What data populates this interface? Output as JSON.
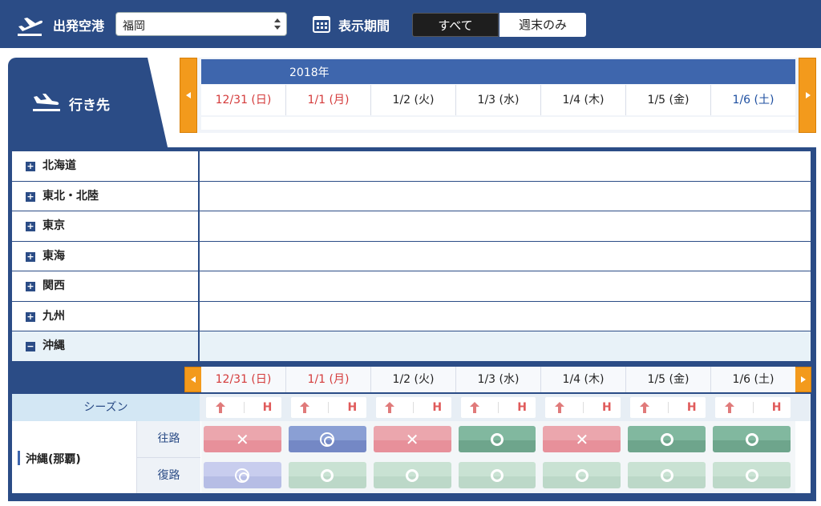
{
  "header": {
    "departure_label": "出発空港",
    "departure_value": "福岡",
    "period_label": "表示期間",
    "period_options": [
      "すべて",
      "週末のみ"
    ],
    "period_selected": "すべて"
  },
  "destination_tab_label": "行き先",
  "calendar": {
    "year_label": "2018年",
    "dates": [
      {
        "label": "12/31 (日)",
        "kind": "holiday"
      },
      {
        "label": "1/1 (月)",
        "kind": "holiday"
      },
      {
        "label": "1/2 (火)",
        "kind": "weekday"
      },
      {
        "label": "1/3 (水)",
        "kind": "weekday"
      },
      {
        "label": "1/4 (木)",
        "kind": "weekday"
      },
      {
        "label": "1/5 (金)",
        "kind": "weekday"
      },
      {
        "label": "1/6 (土)",
        "kind": "saturday"
      }
    ]
  },
  "regions": [
    {
      "name": "北海道",
      "expanded": false
    },
    {
      "name": "東北・北陸",
      "expanded": false
    },
    {
      "name": "東京",
      "expanded": false
    },
    {
      "name": "東海",
      "expanded": false
    },
    {
      "name": "関西",
      "expanded": false
    },
    {
      "name": "九州",
      "expanded": false
    },
    {
      "name": "沖縄",
      "expanded": true
    }
  ],
  "okinawa": {
    "season_label": "シーズン",
    "season_mark": "H",
    "route_name": "沖縄(那覇)",
    "outbound_label": "往路",
    "return_label": "復路",
    "outbound": [
      "x",
      "dd",
      "x",
      "o",
      "x",
      "o",
      "o"
    ],
    "return": [
      "dd-l",
      "o-l",
      "o-l",
      "o-l",
      "o-l",
      "o-l",
      "o-l"
    ]
  },
  "icons": {
    "departure": "plane-takeoff-icon",
    "calendar": "calendar-icon",
    "destination": "plane-landing-icon",
    "season_up": "up-arrow-icon"
  },
  "colors": {
    "primary": "#2b4c86",
    "accent_orange": "#f39a1c",
    "holiday_red": "#d43a3a",
    "saturday_blue": "#1e4fa0",
    "full_red": "#e7909a",
    "available_green": "#6ea58c",
    "double_circle_blue": "#7488c5"
  }
}
